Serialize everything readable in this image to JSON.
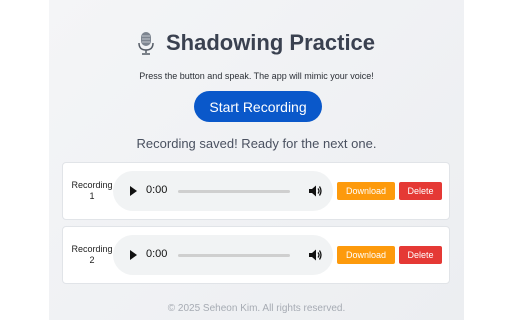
{
  "header": {
    "title": "Shadowing Practice",
    "icon": "microphone-icon",
    "subtitle": "Press the button and speak. The app will mimic your voice!"
  },
  "start_button": {
    "label": "Start Recording"
  },
  "status": "Recording saved! Ready for the next one.",
  "recordings": [
    {
      "label_line1": "Recording",
      "label_line2": "1",
      "time": "0:00",
      "progress": 0,
      "download_label": "Download",
      "delete_label": "Delete"
    },
    {
      "label_line1": "Recording",
      "label_line2": "2",
      "time": "0:00",
      "progress": 0,
      "download_label": "Download",
      "delete_label": "Delete"
    }
  ],
  "footer": "© 2025 Seheon Kim. All rights reserved.",
  "colors": {
    "primary": "#0a58ca",
    "download": "#fd9a0c",
    "delete": "#e53935"
  }
}
